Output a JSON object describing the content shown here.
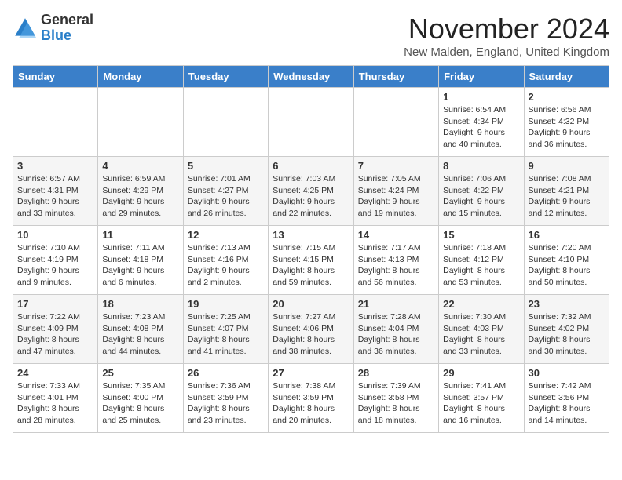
{
  "logo": {
    "general": "General",
    "blue": "Blue"
  },
  "title": "November 2024",
  "subtitle": "New Malden, England, United Kingdom",
  "days_header": [
    "Sunday",
    "Monday",
    "Tuesday",
    "Wednesday",
    "Thursday",
    "Friday",
    "Saturday"
  ],
  "weeks": [
    [
      {
        "day": "",
        "info": ""
      },
      {
        "day": "",
        "info": ""
      },
      {
        "day": "",
        "info": ""
      },
      {
        "day": "",
        "info": ""
      },
      {
        "day": "",
        "info": ""
      },
      {
        "day": "1",
        "info": "Sunrise: 6:54 AM\nSunset: 4:34 PM\nDaylight: 9 hours and 40 minutes."
      },
      {
        "day": "2",
        "info": "Sunrise: 6:56 AM\nSunset: 4:32 PM\nDaylight: 9 hours and 36 minutes."
      }
    ],
    [
      {
        "day": "3",
        "info": "Sunrise: 6:57 AM\nSunset: 4:31 PM\nDaylight: 9 hours and 33 minutes."
      },
      {
        "day": "4",
        "info": "Sunrise: 6:59 AM\nSunset: 4:29 PM\nDaylight: 9 hours and 29 minutes."
      },
      {
        "day": "5",
        "info": "Sunrise: 7:01 AM\nSunset: 4:27 PM\nDaylight: 9 hours and 26 minutes."
      },
      {
        "day": "6",
        "info": "Sunrise: 7:03 AM\nSunset: 4:25 PM\nDaylight: 9 hours and 22 minutes."
      },
      {
        "day": "7",
        "info": "Sunrise: 7:05 AM\nSunset: 4:24 PM\nDaylight: 9 hours and 19 minutes."
      },
      {
        "day": "8",
        "info": "Sunrise: 7:06 AM\nSunset: 4:22 PM\nDaylight: 9 hours and 15 minutes."
      },
      {
        "day": "9",
        "info": "Sunrise: 7:08 AM\nSunset: 4:21 PM\nDaylight: 9 hours and 12 minutes."
      }
    ],
    [
      {
        "day": "10",
        "info": "Sunrise: 7:10 AM\nSunset: 4:19 PM\nDaylight: 9 hours and 9 minutes."
      },
      {
        "day": "11",
        "info": "Sunrise: 7:11 AM\nSunset: 4:18 PM\nDaylight: 9 hours and 6 minutes."
      },
      {
        "day": "12",
        "info": "Sunrise: 7:13 AM\nSunset: 4:16 PM\nDaylight: 9 hours and 2 minutes."
      },
      {
        "day": "13",
        "info": "Sunrise: 7:15 AM\nSunset: 4:15 PM\nDaylight: 8 hours and 59 minutes."
      },
      {
        "day": "14",
        "info": "Sunrise: 7:17 AM\nSunset: 4:13 PM\nDaylight: 8 hours and 56 minutes."
      },
      {
        "day": "15",
        "info": "Sunrise: 7:18 AM\nSunset: 4:12 PM\nDaylight: 8 hours and 53 minutes."
      },
      {
        "day": "16",
        "info": "Sunrise: 7:20 AM\nSunset: 4:10 PM\nDaylight: 8 hours and 50 minutes."
      }
    ],
    [
      {
        "day": "17",
        "info": "Sunrise: 7:22 AM\nSunset: 4:09 PM\nDaylight: 8 hours and 47 minutes."
      },
      {
        "day": "18",
        "info": "Sunrise: 7:23 AM\nSunset: 4:08 PM\nDaylight: 8 hours and 44 minutes."
      },
      {
        "day": "19",
        "info": "Sunrise: 7:25 AM\nSunset: 4:07 PM\nDaylight: 8 hours and 41 minutes."
      },
      {
        "day": "20",
        "info": "Sunrise: 7:27 AM\nSunset: 4:06 PM\nDaylight: 8 hours and 38 minutes."
      },
      {
        "day": "21",
        "info": "Sunrise: 7:28 AM\nSunset: 4:04 PM\nDaylight: 8 hours and 36 minutes."
      },
      {
        "day": "22",
        "info": "Sunrise: 7:30 AM\nSunset: 4:03 PM\nDaylight: 8 hours and 33 minutes."
      },
      {
        "day": "23",
        "info": "Sunrise: 7:32 AM\nSunset: 4:02 PM\nDaylight: 8 hours and 30 minutes."
      }
    ],
    [
      {
        "day": "24",
        "info": "Sunrise: 7:33 AM\nSunset: 4:01 PM\nDaylight: 8 hours and 28 minutes."
      },
      {
        "day": "25",
        "info": "Sunrise: 7:35 AM\nSunset: 4:00 PM\nDaylight: 8 hours and 25 minutes."
      },
      {
        "day": "26",
        "info": "Sunrise: 7:36 AM\nSunset: 3:59 PM\nDaylight: 8 hours and 23 minutes."
      },
      {
        "day": "27",
        "info": "Sunrise: 7:38 AM\nSunset: 3:59 PM\nDaylight: 8 hours and 20 minutes."
      },
      {
        "day": "28",
        "info": "Sunrise: 7:39 AM\nSunset: 3:58 PM\nDaylight: 8 hours and 18 minutes."
      },
      {
        "day": "29",
        "info": "Sunrise: 7:41 AM\nSunset: 3:57 PM\nDaylight: 8 hours and 16 minutes."
      },
      {
        "day": "30",
        "info": "Sunrise: 7:42 AM\nSunset: 3:56 PM\nDaylight: 8 hours and 14 minutes."
      }
    ]
  ]
}
